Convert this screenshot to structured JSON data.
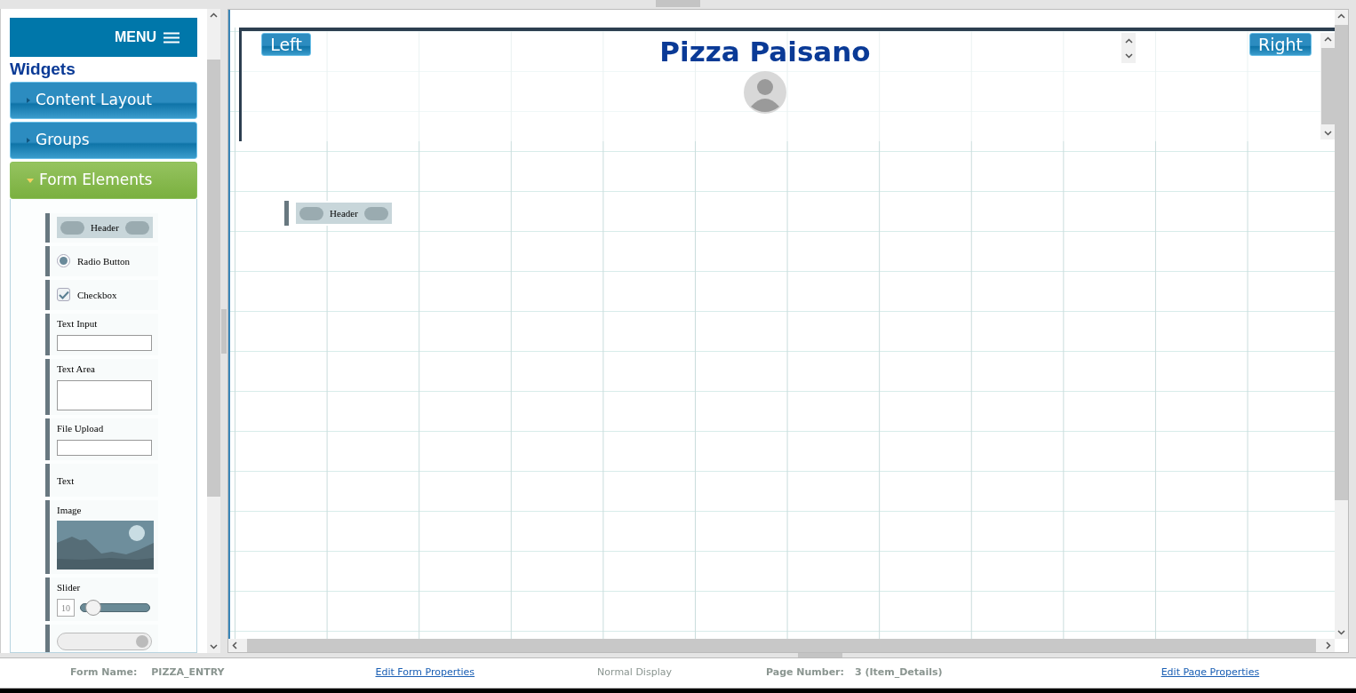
{
  "sidebar": {
    "menu_label": "MENU",
    "title": "Widgets",
    "sections": [
      {
        "label": "Content Layout",
        "expanded": false
      },
      {
        "label": "Groups",
        "expanded": false
      },
      {
        "label": "Form Elements",
        "expanded": true
      }
    ],
    "widgets": [
      {
        "kind": "header",
        "label": "Header"
      },
      {
        "kind": "radio",
        "label": "Radio Button",
        "checked": true
      },
      {
        "kind": "checkbox",
        "label": "Checkbox",
        "checked": true
      },
      {
        "kind": "text_input",
        "label": "Text Input"
      },
      {
        "kind": "text_area",
        "label": "Text Area"
      },
      {
        "kind": "file_upload",
        "label": "File Upload"
      },
      {
        "kind": "text",
        "label": "Text"
      },
      {
        "kind": "image",
        "label": "Image"
      },
      {
        "kind": "slider",
        "label": "Slider",
        "value": "10",
        "level": 0.18
      },
      {
        "kind": "select"
      }
    ]
  },
  "canvas": {
    "header": {
      "left_button": "Left",
      "title": "Pizza Paisano",
      "right_button": "Right"
    },
    "placed_widgets": [
      {
        "kind": "header",
        "label": "Header"
      }
    ]
  },
  "status_bar": {
    "form_name_label": "Form Name:",
    "form_name": "PIZZA_ENTRY",
    "edit_form_link": "Edit Form Properties",
    "display_mode": "Normal Display",
    "page_number_label": "Page Number:",
    "page_number": "3 (Item_Details)",
    "edit_page_link": "Edit Page Properties"
  }
}
